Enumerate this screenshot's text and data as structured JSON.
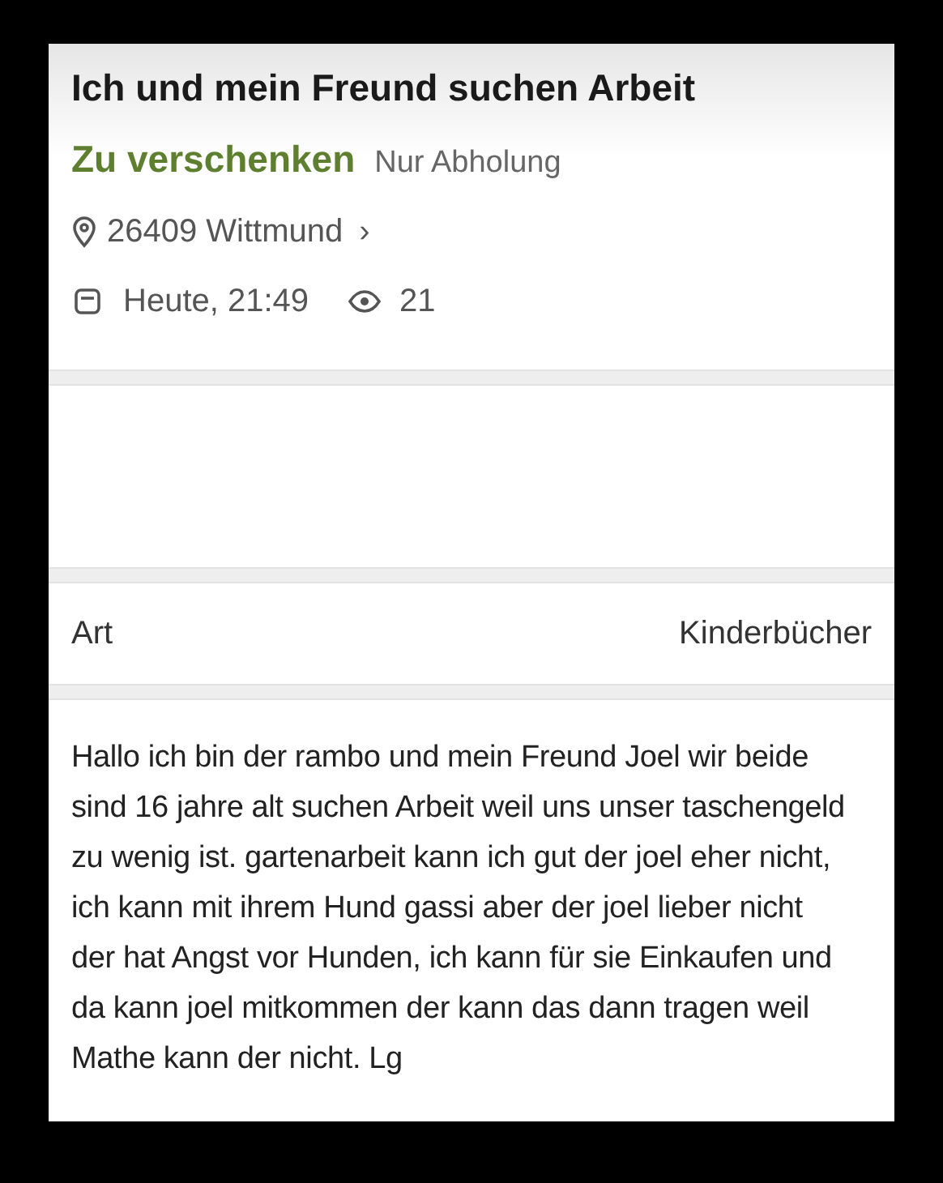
{
  "title": "Ich und mein Freund suchen Arbeit",
  "price": "Zu verschenken",
  "shipping": "Nur Abholung",
  "location": {
    "text": "26409 Wittmund",
    "chevron": "›"
  },
  "posted": "Heute, 21:49",
  "views": "21",
  "attributes": [
    {
      "label": "Art",
      "value": "Kinderbücher"
    }
  ],
  "description": "Hallo ich bin der rambo und mein Freund Joel wir beide sind 16 jahre alt suchen Arbeit weil uns unser taschengeld zu wenig ist. gartenarbeit kann ich gut der joel eher nicht, ich kann mit ihrem Hund gassi aber der joel lieber nicht der hat Angst vor Hunden, ich kann für sie Einkaufen und da kann joel mitkommen der kann das dann tragen weil Mathe kann der nicht. Lg"
}
